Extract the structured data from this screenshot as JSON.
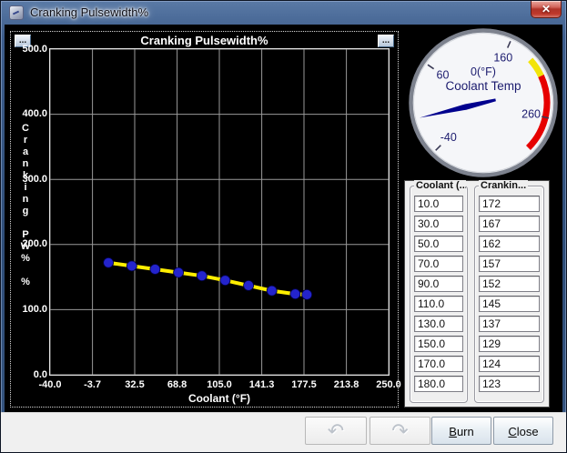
{
  "window": {
    "title": "Cranking Pulsewidth%",
    "close_glyph": "✕"
  },
  "chart_panel": {
    "options_glyph": "..."
  },
  "chart_data": {
    "type": "line",
    "title": "Cranking Pulsewidth%",
    "xlabel": "Coolant (°F)",
    "ylabel": "Cranking PW%",
    "ylabel_vertical": "Cranking PW% %",
    "x": [
      10,
      30,
      50,
      70,
      90,
      110,
      130,
      150,
      170,
      180
    ],
    "y": [
      172,
      167,
      162,
      157,
      152,
      145,
      137,
      129,
      124,
      123
    ],
    "xlim": [
      -40,
      250
    ],
    "ylim": [
      0,
      500
    ],
    "xticks": [
      -40.0,
      -3.7,
      32.5,
      68.8,
      105.0,
      141.3,
      177.5,
      213.8,
      250.0
    ],
    "xtick_labels": [
      "-40.0",
      "-3.7",
      "32.5",
      "68.8",
      "105.0",
      "141.3",
      "177.5",
      "213.8",
      "250.0"
    ],
    "yticks": [
      0,
      100,
      200,
      300,
      400,
      500
    ],
    "ytick_labels": [
      "0.0",
      "100.0",
      "200.0",
      "300.0",
      "400.0",
      "500.0"
    ],
    "grid": true,
    "grid_color": "#9a9a9a",
    "line_color": "#ffee00",
    "point_color": "#2424cc",
    "background": "#000000"
  },
  "gauge": {
    "title": "Coolant Temp",
    "value_text": "0(°F)",
    "value": 0,
    "min": -40,
    "max": 300,
    "start_angle": 225,
    "end_angle": -45,
    "tick_values": [
      -40,
      60,
      160,
      260
    ],
    "tick_labels": [
      "-40",
      "60",
      "160",
      "260"
    ],
    "zones": [
      {
        "from": 190,
        "to": 212,
        "color": "#f2e40a"
      },
      {
        "from": 212,
        "to": 300,
        "color": "#e60000"
      }
    ],
    "needle_color": "#00008e",
    "face_color": "#f5f6f9",
    "rim_color": "#7d828e",
    "text_color": "#1b1b6e"
  },
  "table": {
    "columns": [
      {
        "label": "Coolant (...",
        "values": [
          "10.0",
          "30.0",
          "50.0",
          "70.0",
          "90.0",
          "110.0",
          "130.0",
          "150.0",
          "170.0",
          "180.0"
        ]
      },
      {
        "label": "Crankin...",
        "values": [
          "172",
          "167",
          "162",
          "157",
          "152",
          "145",
          "137",
          "129",
          "124",
          "123"
        ]
      }
    ]
  },
  "footer": {
    "undo_glyph": "↶",
    "redo_glyph": "↷",
    "burn_label": "Burn",
    "close_label": "Close"
  }
}
